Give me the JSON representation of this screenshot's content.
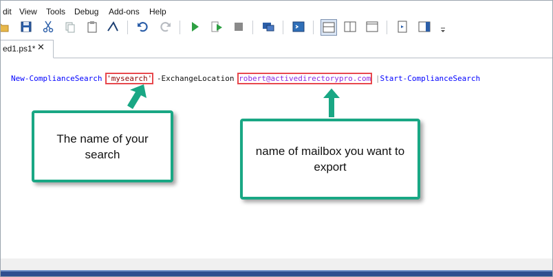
{
  "menu": {
    "items": [
      {
        "label": "dit"
      },
      {
        "label": "View"
      },
      {
        "label": "Tools"
      },
      {
        "label": "Debug"
      },
      {
        "label": "Add-ons"
      },
      {
        "label": "Help"
      }
    ]
  },
  "toolbar": {
    "buttons": [
      "open-folder-icon",
      "save-icon",
      "cut-icon",
      "copy-icon",
      "paste-icon",
      "clear-console-icon",
      "undo-icon",
      "redo-icon",
      "run-icon",
      "run-selection-icon",
      "stop-icon",
      "remote-powershell-icon",
      "powershell-console-icon",
      "show-script-top-icon",
      "show-script-right-icon",
      "show-script-maximized-icon",
      "show-command-window-icon",
      "show-command-addon-icon",
      "toolbar-overflow-icon"
    ]
  },
  "tab": {
    "label": "ed1.ps1*",
    "close": "✕"
  },
  "code": {
    "cmd1": "New-ComplianceSearch",
    "name_value": "'mysearch'",
    "param": "-ExchangeLocation",
    "mailbox": "robert@activedirectorypro.com",
    "pipe": "|",
    "cmd2": "Start-ComplianceSearch"
  },
  "callouts": {
    "search_name": "The name of your search",
    "mailbox": "name of mailbox you want to export"
  },
  "colors": {
    "accent": "#19a784",
    "highlight": "#e8474c",
    "cmdlet": "#0000ff",
    "string": "#8b0000",
    "email": "#8a2be2"
  }
}
